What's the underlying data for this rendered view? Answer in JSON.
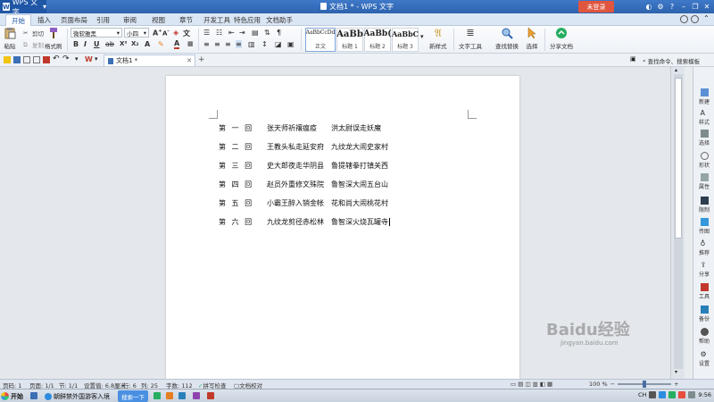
{
  "titlebar": {
    "app_name": "WPS 文字",
    "doc_title": "文档1 * - WPS 文字",
    "login": "未登录"
  },
  "menu": {
    "tabs": [
      "开始",
      "插入",
      "页面布局",
      "引用",
      "审阅",
      "视图",
      "章节",
      "开发工具",
      "特色应用",
      "文档助手"
    ]
  },
  "ribbon": {
    "paste": "粘贴",
    "cut": "剪切",
    "copy": "复制",
    "format_painter": "格式刷",
    "font_name": "微软雅黑",
    "font_size": "小四",
    "styles": [
      {
        "sample": "AaBbCcDd",
        "label": "正文"
      },
      {
        "sample": "AaBb",
        "label": "标题 1"
      },
      {
        "sample": "AaBb(",
        "label": "标题 2"
      },
      {
        "sample": "AaBbC",
        "label": "标题 3"
      }
    ],
    "new_style": "新样式",
    "text_tools": "文字工具",
    "find_replace": "查找替换",
    "select": "选择",
    "share_doc": "分享文档"
  },
  "toolbar": {
    "doc_tab": "文档1 *",
    "search_cmd": "查找命令、搜索模板"
  },
  "document": {
    "lines": [
      {
        "hui": "第 一 回",
        "part1": "张天师祈禳瘟疫",
        "part2": "洪太尉误走妖魔"
      },
      {
        "hui": "第 二 回",
        "part1": "王教头私走延安府",
        "part2": "九纹龙大闹史家村"
      },
      {
        "hui": "第 三 回",
        "part1": "史大郎夜走华阴县",
        "part2": "鲁提辖拳打镇关西"
      },
      {
        "hui": "第 四 回",
        "part1": "赵员外重修文殊院",
        "part2": "鲁智深大闹五台山"
      },
      {
        "hui": "第 五 回",
        "part1": "小霸王醉入销金帐",
        "part2": "花和尚大闹桃花村"
      },
      {
        "hui": "第 六 回",
        "part1": "九纹龙剪径赤松林",
        "part2": "鲁智深火烧瓦罐寺"
      }
    ]
  },
  "sidebar": {
    "items": [
      "新建",
      "样式",
      "选择",
      "形状",
      "属性",
      "限制",
      "传图",
      "推荐",
      "分享",
      "工具",
      "备份",
      "帮助",
      "设置"
    ]
  },
  "statusbar": {
    "page_no": "页码: 1",
    "pages": "页面: 1/1",
    "section": "节: 1/1",
    "setting": "设置值: 6.8厘米",
    "row": "行: 6",
    "col": "列: 25",
    "words": "字数: 112",
    "spell": "拼写检查",
    "proof": "文档校对",
    "zoom": "100 %"
  },
  "taskbar": {
    "start": "开始",
    "item1": "朝鲜禁外国游客入境",
    "search_btn": "搜索一下",
    "ime": "CH",
    "clock": "9:56"
  },
  "watermark": {
    "brand": "Baidu经验",
    "url": "jingyan.baidu.com"
  },
  "colors": {
    "title_blue": "#2d63ad",
    "login_red": "#e0553d",
    "ribbon_bg": "#eef2f7"
  }
}
